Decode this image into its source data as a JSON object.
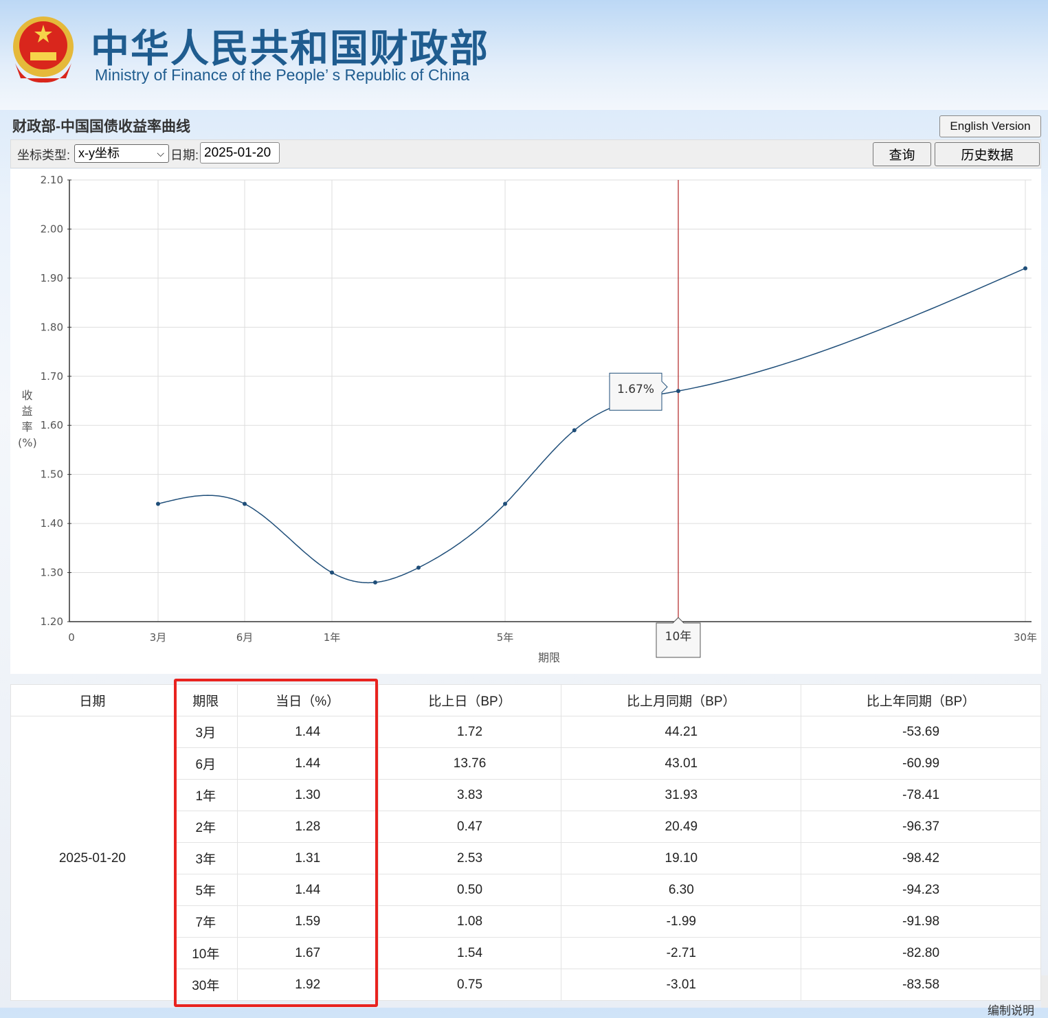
{
  "header": {
    "title_cn": "中华人民共和国财政部",
    "title_en": "Ministry of Finance of the People’ s Republic of China"
  },
  "page_title": "财政部-中国国债收益率曲线",
  "english_version": "English Version",
  "toolbar": {
    "coord_label": "坐标类型:",
    "coord_value": "x-y坐标",
    "date_label": "日期:",
    "date_value": "2025-01-20",
    "query": "查询",
    "history": "历史数据"
  },
  "chart_data": {
    "type": "line",
    "xlabel": "期限",
    "ylabel": "收益率(%)",
    "ylabel_chars": [
      "收",
      "益",
      "率",
      "(%)"
    ],
    "ylim": [
      1.2,
      2.1
    ],
    "yticks": [
      "1.20",
      "1.30",
      "1.40",
      "1.50",
      "1.60",
      "1.70",
      "1.80",
      "1.90",
      "2.00",
      "2.10"
    ],
    "xticks": [
      {
        "label": "0",
        "years": 0
      },
      {
        "label": "3月",
        "years": 0.25
      },
      {
        "label": "6月",
        "years": 0.5
      },
      {
        "label": "1年",
        "years": 1
      },
      {
        "label": "5年",
        "years": 5
      },
      {
        "label": "10年",
        "years": 10
      },
      {
        "label": "30年",
        "years": 30
      }
    ],
    "x_years": [
      0.25,
      0.5,
      1,
      2,
      3,
      5,
      7,
      10,
      30
    ],
    "values": [
      1.44,
      1.44,
      1.3,
      1.28,
      1.31,
      1.44,
      1.59,
      1.67,
      1.92
    ],
    "tooltip": {
      "value": "1.67%",
      "term": "10年",
      "years": 10
    },
    "line_color": "#1f4e79",
    "cursor_color": "#b22222",
    "grid": true
  },
  "table": {
    "headers": [
      "日期",
      "期限",
      "当日（%）",
      "比上日（BP）",
      "比上月同期（BP）",
      "比上年同期（BP）"
    ],
    "date": "2025-01-20",
    "rows": [
      [
        "3月",
        "1.44",
        "1.72",
        "44.21",
        "-53.69"
      ],
      [
        "6月",
        "1.44",
        "13.76",
        "43.01",
        "-60.99"
      ],
      [
        "1年",
        "1.30",
        "3.83",
        "31.93",
        "-78.41"
      ],
      [
        "2年",
        "1.28",
        "0.47",
        "20.49",
        "-96.37"
      ],
      [
        "3年",
        "1.31",
        "2.53",
        "19.10",
        "-98.42"
      ],
      [
        "5年",
        "1.44",
        "0.50",
        "6.30",
        "-94.23"
      ],
      [
        "7年",
        "1.59",
        "1.08",
        "-1.99",
        "-91.98"
      ],
      [
        "10年",
        "1.67",
        "1.54",
        "-2.71",
        "-82.80"
      ],
      [
        "30年",
        "1.92",
        "0.75",
        "-3.01",
        "-83.58"
      ]
    ]
  },
  "note": "编制说明"
}
